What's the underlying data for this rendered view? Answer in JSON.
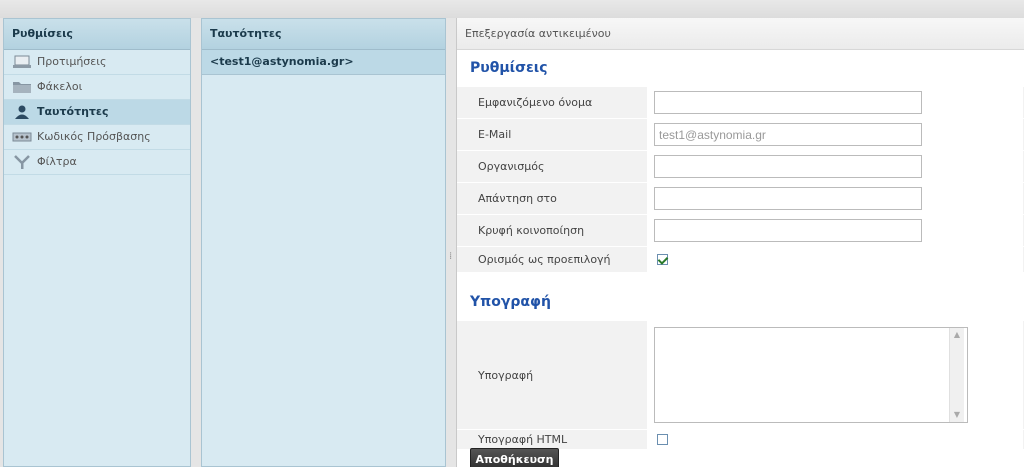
{
  "settings_panel": {
    "title": "Ρυθμίσεις",
    "items": [
      {
        "label": "Προτιμήσεις",
        "icon": "laptop-icon"
      },
      {
        "label": "Φάκελοι",
        "icon": "folder-icon"
      },
      {
        "label": "Ταυτότητες",
        "icon": "user-icon",
        "selected": true
      },
      {
        "label": "Κωδικός Πρόσβασης",
        "icon": "password-icon"
      },
      {
        "label": "Φίλτρα",
        "icon": "filter-icon"
      }
    ]
  },
  "identities_panel": {
    "title": "Ταυτότητες",
    "items": [
      {
        "label": "<test1@astynomia.gr>"
      }
    ]
  },
  "edit_frame": {
    "title": "Επεξεργασία αντικειμένου",
    "settings_section": {
      "title": "Ρυθμίσεις",
      "fields": {
        "display_name": {
          "label": "Εμφανιζόμενο όνομα",
          "value": ""
        },
        "email": {
          "label": "E-Mail",
          "value": "test1@astynomia.gr"
        },
        "organization": {
          "label": "Οργανισμός",
          "value": ""
        },
        "reply_to": {
          "label": "Απάντηση στο",
          "value": ""
        },
        "bcc": {
          "label": "Κρυφή κοινοποίηση",
          "value": ""
        },
        "set_default": {
          "label": "Ορισμός ως προεπιλογή",
          "checked": true
        }
      }
    },
    "signature_section": {
      "title": "Υπογραφή",
      "fields": {
        "signature": {
          "label": "Υπογραφή",
          "value": ""
        },
        "html_signature": {
          "label": "Υπογραφή HTML",
          "checked": false
        }
      }
    },
    "save_label": "Αποθήκευση"
  },
  "colors": {
    "panel_bg": "#d8eaf2",
    "selected_bg": "#bcd9e6",
    "section_title": "#2153a8",
    "save_button": "#333333"
  }
}
